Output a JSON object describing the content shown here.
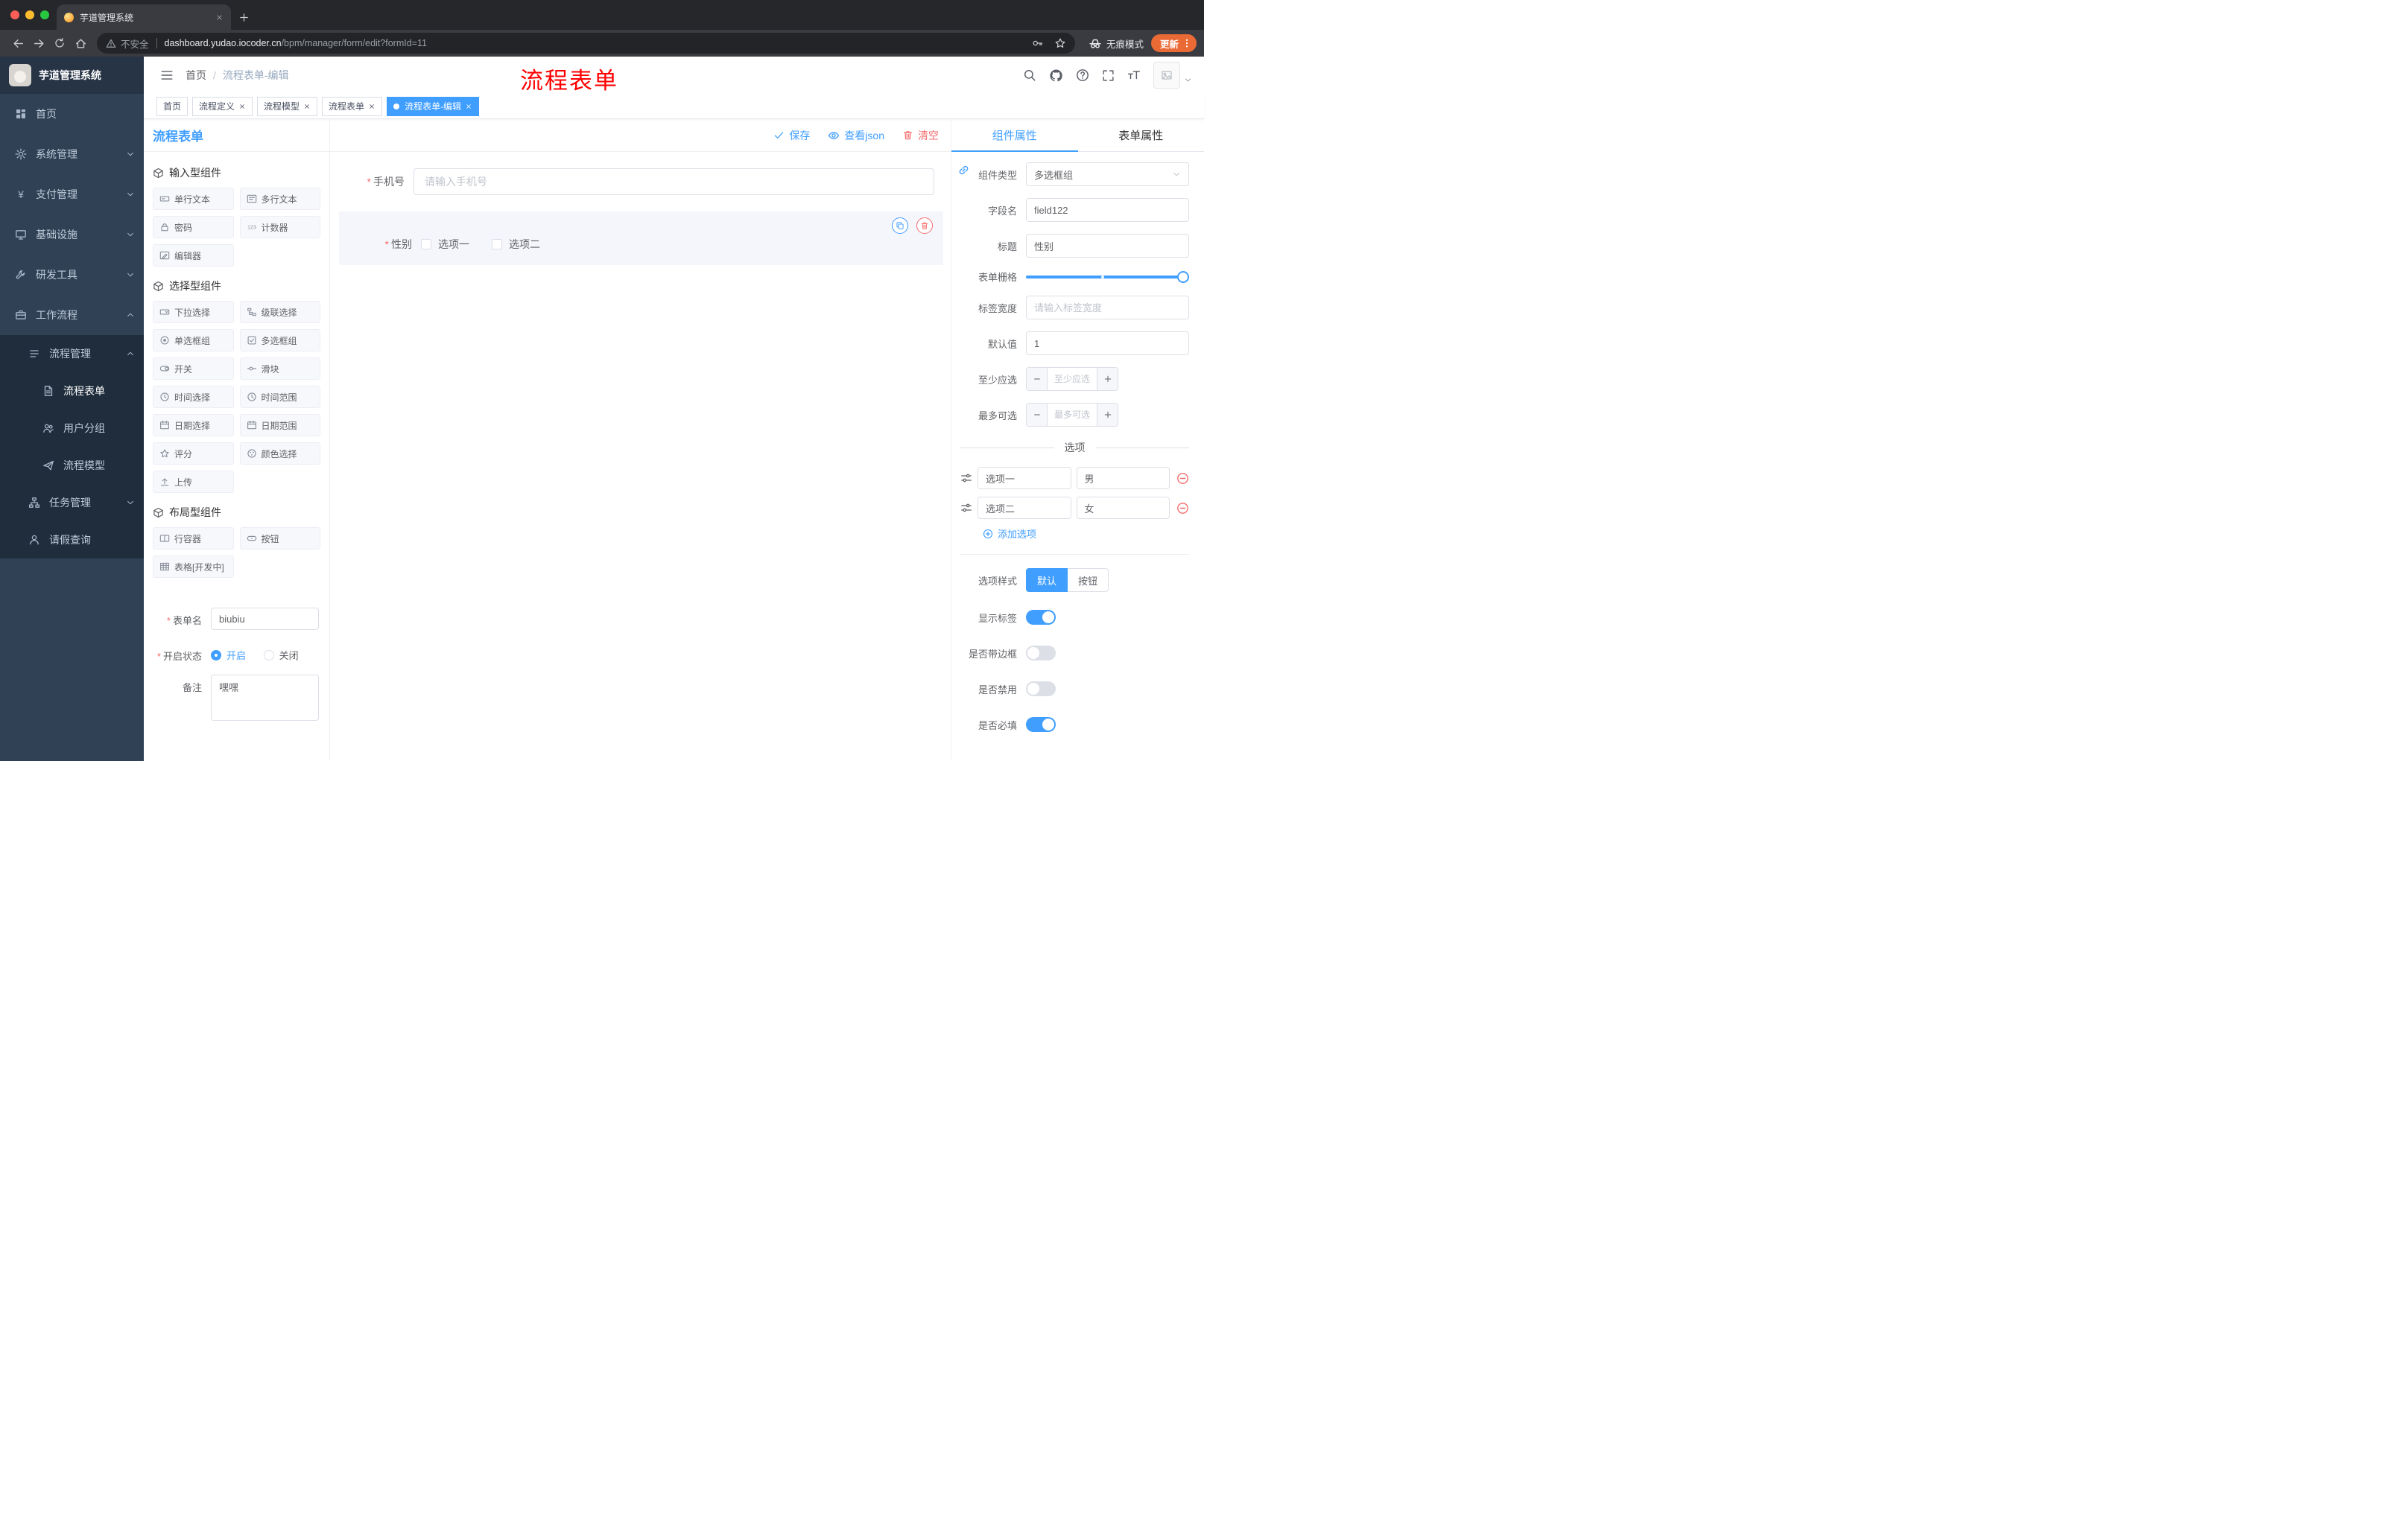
{
  "colors": {
    "accent": "#409eff",
    "danger": "#f56c6c",
    "sidebar_bg": "#304156",
    "submenu_bg": "#1f2d3d",
    "update_pill": "#ea6a35",
    "annotation": "#ff0000"
  },
  "browser": {
    "tab_title": "芋道管理系统",
    "security_label": "不安全",
    "url_domain": "dashboard.yudao.iocoder.cn",
    "url_path": "/bpm/manager/form/edit?formId=11",
    "incognito_label": "无痕模式",
    "update_label": "更新"
  },
  "annotation_text": "流程表单",
  "sidebar": {
    "logo_title": "芋道管理系统",
    "items": [
      {
        "label": "首页",
        "icon": "dashboard-icon"
      },
      {
        "label": "系统管理",
        "icon": "gear-icon",
        "arrow": "down"
      },
      {
        "label": "支付管理",
        "icon": "yen-icon",
        "arrow": "down"
      },
      {
        "label": "基础设施",
        "icon": "monitor-icon",
        "arrow": "down"
      },
      {
        "label": "研发工具",
        "icon": "wrench-icon",
        "arrow": "down"
      },
      {
        "label": "工作流程",
        "icon": "briefcase-icon",
        "arrow": "up"
      },
      {
        "label": "流程管理",
        "icon": "list-icon",
        "arrow": "up"
      },
      {
        "label": "流程表单",
        "icon": "document-icon",
        "active": true
      },
      {
        "label": "用户分组",
        "icon": "users-icon"
      },
      {
        "label": "流程模型",
        "icon": "paper-plane-icon"
      },
      {
        "label": "任务管理",
        "icon": "tree-icon",
        "arrow": "down"
      },
      {
        "label": "请假查询",
        "icon": "user-icon"
      }
    ]
  },
  "navbar": {
    "breadcrumb_home": "首页",
    "breadcrumb_sep": "/",
    "breadcrumb_current": "流程表单-编辑"
  },
  "tags": [
    {
      "label": "首页"
    },
    {
      "label": "流程定义"
    },
    {
      "label": "流程模型"
    },
    {
      "label": "流程表单"
    },
    {
      "label": "流程表单-编辑"
    }
  ],
  "designer": {
    "title": "流程表单",
    "actions": {
      "save": "保存",
      "view_json": "查看json",
      "clear": "清空"
    },
    "palette_sections": [
      {
        "title": "输入型组件",
        "items": [
          {
            "label": "单行文本",
            "icon": "input-icon"
          },
          {
            "label": "多行文本",
            "icon": "textarea-icon"
          },
          {
            "label": "密码",
            "icon": "lock-icon"
          },
          {
            "label": "计数器",
            "icon": "counter-icon"
          },
          {
            "label": "编辑器",
            "icon": "editor-icon"
          }
        ]
      },
      {
        "title": "选择型组件",
        "items": [
          {
            "label": "下拉选择",
            "icon": "select-icon"
          },
          {
            "label": "级联选择",
            "icon": "cascade-icon"
          },
          {
            "label": "单选框组",
            "icon": "radio-icon"
          },
          {
            "label": "多选框组",
            "icon": "checkbox-icon"
          },
          {
            "label": "开关",
            "icon": "switch-icon"
          },
          {
            "label": "滑块",
            "icon": "slider-icon"
          },
          {
            "label": "时间选择",
            "icon": "clock-icon"
          },
          {
            "label": "时间范围",
            "icon": "clock-range-icon"
          },
          {
            "label": "日期选择",
            "icon": "calendar-icon"
          },
          {
            "label": "日期范围",
            "icon": "calendar-range-icon"
          },
          {
            "label": "评分",
            "icon": "star-icon"
          },
          {
            "label": "颜色选择",
            "icon": "color-icon"
          },
          {
            "label": "上传",
            "icon": "upload-icon"
          }
        ]
      },
      {
        "title": "布局型组件",
        "items": [
          {
            "label": "行容器",
            "icon": "row-container-icon"
          },
          {
            "label": "按钮",
            "icon": "button-icon"
          },
          {
            "label": "表格[开发中]",
            "icon": "table-icon"
          }
        ]
      }
    ],
    "meta": {
      "form_name_label": "表单名",
      "form_name_value": "biubiu",
      "status_label": "开启状态",
      "status_on": "开启",
      "status_off": "关闭",
      "remark_label": "备注",
      "remark_value": "嘿嘿"
    },
    "canvas": {
      "phone_label": "手机号",
      "phone_placeholder": "请输入手机号",
      "gender_label": "性别",
      "gender_option1": "选项一",
      "gender_option2": "选项二"
    }
  },
  "props": {
    "tab_component": "组件属性",
    "tab_form": "表单属性",
    "component_type_label": "组件类型",
    "component_type_value": "多选框组",
    "field_name_label": "字段名",
    "field_name_value": "field122",
    "title_label": "标题",
    "title_value": "性别",
    "grid_label": "表单栅格",
    "label_width_label": "标签宽度",
    "label_width_placeholder": "请输入标签宽度",
    "default_label": "默认值",
    "default_value": "1",
    "min_label": "至少应选",
    "min_placeholder": "至少应选",
    "max_label": "最多可选",
    "max_placeholder": "最多可选",
    "options_title": "选项",
    "options": [
      {
        "label": "选项一",
        "value": "男"
      },
      {
        "label": "选项二",
        "value": "女"
      }
    ],
    "add_option": "添加选项",
    "style_label": "选项样式",
    "style_default": "默认",
    "style_button": "按钮",
    "toggle_show_label": "显示标签",
    "toggle_border": "是否带边框",
    "toggle_disabled": "是否禁用",
    "toggle_required": "是否必填"
  }
}
